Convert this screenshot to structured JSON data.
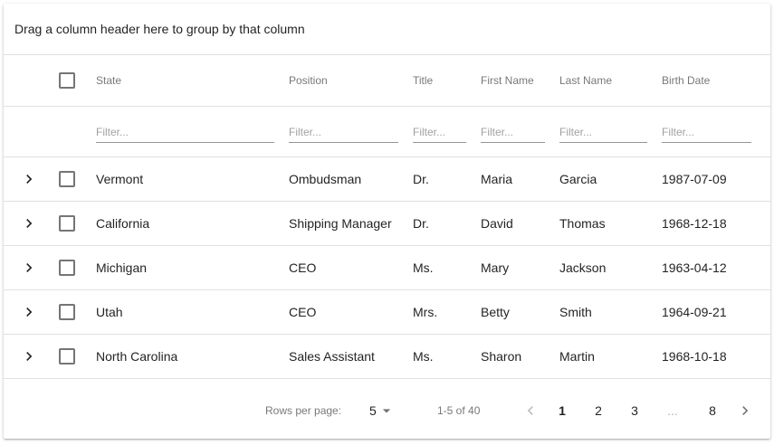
{
  "group_panel": {
    "hint": "Drag a column header here to group by that column"
  },
  "columns": [
    "State",
    "Position",
    "Title",
    "First Name",
    "Last Name",
    "Birth Date"
  ],
  "filter_placeholder": "Filter...",
  "rows": [
    [
      "Vermont",
      "Ombudsman",
      "Dr.",
      "Maria",
      "Garcia",
      "1987-07-09"
    ],
    [
      "California",
      "Shipping Manager",
      "Dr.",
      "David",
      "Thomas",
      "1968-12-18"
    ],
    [
      "Michigan",
      "CEO",
      "Ms.",
      "Mary",
      "Jackson",
      "1963-04-12"
    ],
    [
      "Utah",
      "CEO",
      "Mrs.",
      "Betty",
      "Smith",
      "1964-09-21"
    ],
    [
      "North Carolina",
      "Sales Assistant",
      "Ms.",
      "Sharon",
      "Martin",
      "1968-10-18"
    ]
  ],
  "pager": {
    "rows_per_page_label": "Rows per page:",
    "rows_per_page_value": "5",
    "range_info": "1-5 of 40",
    "pages": [
      "1",
      "2",
      "3",
      "...",
      "8"
    ],
    "active_page": "1"
  },
  "icons": {
    "expander": "chevron-right-icon",
    "dropdown": "arrow-drop-down-icon",
    "prev": "chevron-left-icon",
    "next": "chevron-right-icon"
  }
}
